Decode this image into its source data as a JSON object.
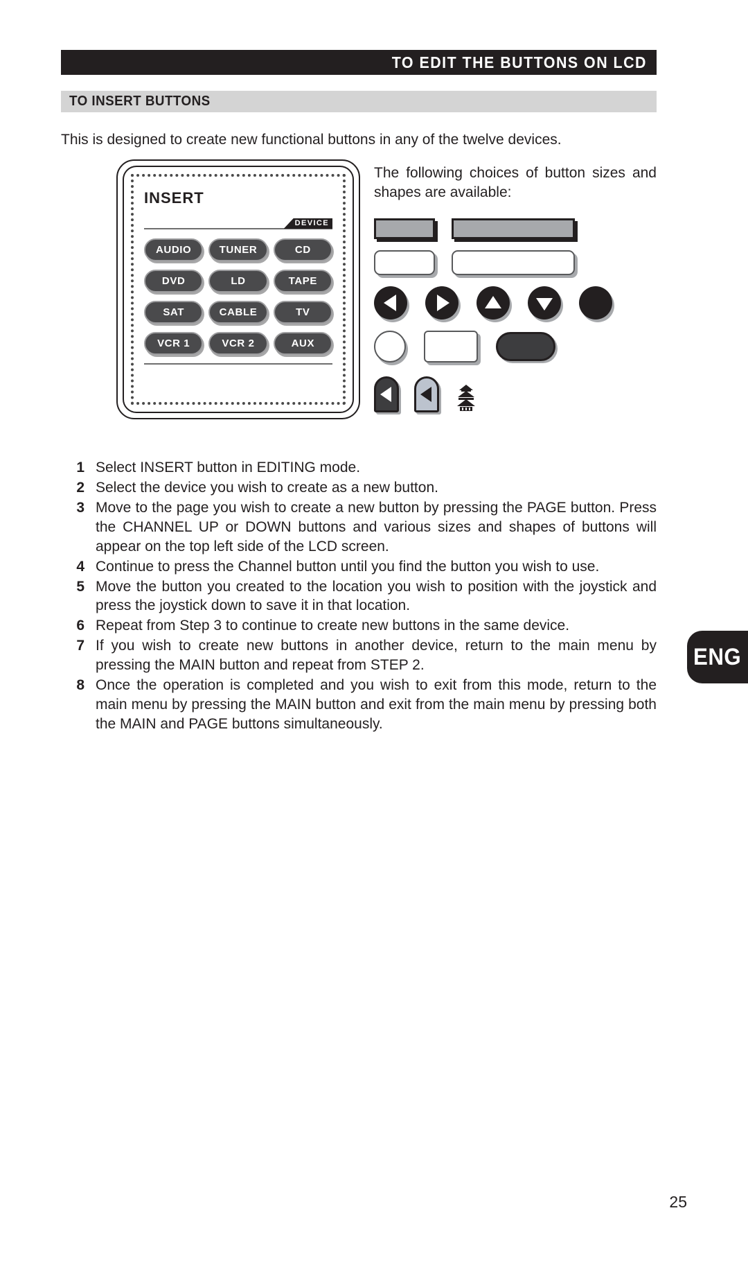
{
  "header": {
    "title": "TO EDIT THE BUTTONS ON LCD",
    "section_title": "TO INSERT BUTTONS"
  },
  "intro": "This is designed to create new functional buttons in any of the twelve devices.",
  "lcd": {
    "screen_title": "INSERT",
    "device_tab_label": "DEVICE",
    "buttons": [
      "AUDIO",
      "TUNER",
      "CD",
      "DVD",
      "LD",
      "TAPE",
      "SAT",
      "CABLE",
      "TV",
      "VCR 1",
      "VCR 2",
      "AUX"
    ]
  },
  "shapes_intro": "The following choices of button sizes and shapes are available:",
  "shapes": {
    "row1": [
      "filled-bar-small",
      "filled-bar-large"
    ],
    "row2": [
      "outline-bar-small",
      "outline-bar-large"
    ],
    "row3": [
      "arrow-left-circle",
      "arrow-right-circle",
      "arrow-up-circle",
      "arrow-down-circle",
      "plain-circle-filled"
    ],
    "row4": [
      "outline-circle",
      "outline-rectangle",
      "dark-pill"
    ],
    "row5": [
      "arch-dark-left-arrow",
      "arch-light-left-arrow",
      "pagoda-icon"
    ]
  },
  "steps": [
    {
      "num": "1",
      "text": "Select INSERT button in EDITING mode."
    },
    {
      "num": "2",
      "text": "Select the device you wish to create as a new button."
    },
    {
      "num": "3",
      "text": "Move to the page you wish to create a new button by pressing the PAGE button. Press the CHANNEL UP or DOWN buttons and various sizes and shapes of buttons will appear on the top left side of the LCD screen."
    },
    {
      "num": "4",
      "text": "Continue to press the Channel button until you find the button you wish to use."
    },
    {
      "num": "5",
      "text": "Move the button you created to the location you wish to position with the joystick and press the joystick down to save it in that location."
    },
    {
      "num": "6",
      "text": "Repeat from Step 3 to continue to create new buttons in the same device."
    },
    {
      "num": "7",
      "text": "If you wish to create new buttons in another device, return to the main menu by pressing the MAIN button and repeat from STEP 2."
    },
    {
      "num": "8",
      "text": "Once the operation is completed and you wish to exit from this mode, return to the main menu by pressing the MAIN button and exit from the main menu by pressing both the MAIN and PAGE buttons simultaneously."
    }
  ],
  "language_tab": "ENG",
  "page_number": "25",
  "colors": {
    "ink": "#231f20",
    "subbar": "#d4d4d4",
    "button_face": "#4a4a4c",
    "shape_fill": "#a7a9ac",
    "arch_light": "#bcc3ce"
  }
}
